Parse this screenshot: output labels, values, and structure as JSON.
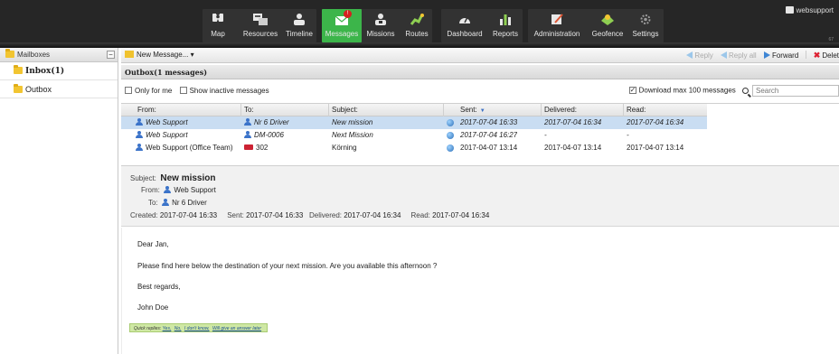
{
  "nav": {
    "groups": [
      [
        {
          "id": "map",
          "label": "Map",
          "icon": "map-pin-icon"
        },
        {
          "id": "resources",
          "label": "Resources",
          "icon": "resources-icon"
        },
        {
          "id": "timeline",
          "label": "Timeline",
          "icon": "timeline-icon"
        }
      ],
      [
        {
          "id": "messages",
          "label": "Messages",
          "icon": "envelope-icon",
          "active": true,
          "badge": "!"
        },
        {
          "id": "missions",
          "label": "Missions",
          "icon": "missions-icon"
        },
        {
          "id": "routes",
          "label": "Routes",
          "icon": "routes-icon"
        }
      ],
      [
        {
          "id": "dashboard",
          "label": "Dashboard",
          "icon": "gauge-icon"
        },
        {
          "id": "reports",
          "label": "Reports",
          "icon": "bar-chart-icon"
        }
      ],
      [
        {
          "id": "administration",
          "label": "Administration",
          "icon": "admin-icon"
        },
        {
          "id": "geofence",
          "label": "Geofence",
          "icon": "geofence-icon"
        },
        {
          "id": "settings",
          "label": "Settings",
          "icon": "gear-icon"
        }
      ]
    ],
    "user": "websupport",
    "user_sub": "67"
  },
  "sidebar": {
    "title": "Mailboxes",
    "collapse": "−",
    "items": [
      {
        "label": "Inbox(1)",
        "selected": true
      },
      {
        "label": "Outbox",
        "selected": false
      }
    ]
  },
  "toolbar": {
    "new_message": "New Message... ▾",
    "reply": "Reply",
    "reply_all": "Reply all",
    "forward": "Forward",
    "delete": "Delet"
  },
  "outbox": {
    "title": "Outbox(1 messages)"
  },
  "filters": {
    "only_for_me": "Only for me",
    "show_inactive": "Show inactive messages",
    "download_max": "Download max 100 messages",
    "search_placeholder": "Search"
  },
  "table": {
    "headers": {
      "from": "From:",
      "to": "To:",
      "subject": "Subject:",
      "sent": "Sent:",
      "delivered": "Delivered:",
      "read": "Read:"
    },
    "rows": [
      {
        "from": "Web Support",
        "to": "Nr 6 Driver",
        "to_type": "person",
        "subject": "New mission",
        "sent": "2017-07-04 16:33",
        "delivered": "2017-07-04 16:34",
        "read": "2017-07-04 16:34",
        "selected": true,
        "italic": true
      },
      {
        "from": "Web Support",
        "to": "DM-0006",
        "to_type": "person",
        "subject": "Next Mission",
        "sent": "2017-07-04 16:27",
        "delivered": "-",
        "read": "-",
        "selected": false,
        "italic": true
      },
      {
        "from": "Web Support (Office Team)",
        "to": "302",
        "to_type": "vehicle",
        "subject": "Körning",
        "sent": "2017-04-07 13:14",
        "delivered": "2017-04-07 13:14",
        "read": "2017-04-07 13:14",
        "selected": false,
        "italic": false
      }
    ]
  },
  "preview": {
    "subject_label": "Subject:",
    "subject": "New mission",
    "from_label": "From:",
    "from": "Web Support",
    "to_label": "To:",
    "to": "Nr 6 Driver",
    "created_label": "Created:",
    "created": "2017-07-04 16:33",
    "sent_label": "Sent:",
    "sent": "2017-07-04 16:33",
    "delivered_label": "Delivered:",
    "delivered": "2017-07-04 16:34",
    "read_label": "Read:",
    "read": "2017-07-04 16:34",
    "body": [
      "Dear Jan,",
      "Please find here below the destination of your next mission. Are you available this afternoon ?",
      "Best regards,",
      "John Doe"
    ],
    "quick_label": "Quick replies:",
    "quick_replies": [
      "Yes,",
      "No,",
      "I don't know,",
      "Will give an answer later"
    ]
  },
  "colors": {
    "accent": "#3cb54a",
    "selection": "#c9ddf2",
    "badge": "#d62020"
  }
}
